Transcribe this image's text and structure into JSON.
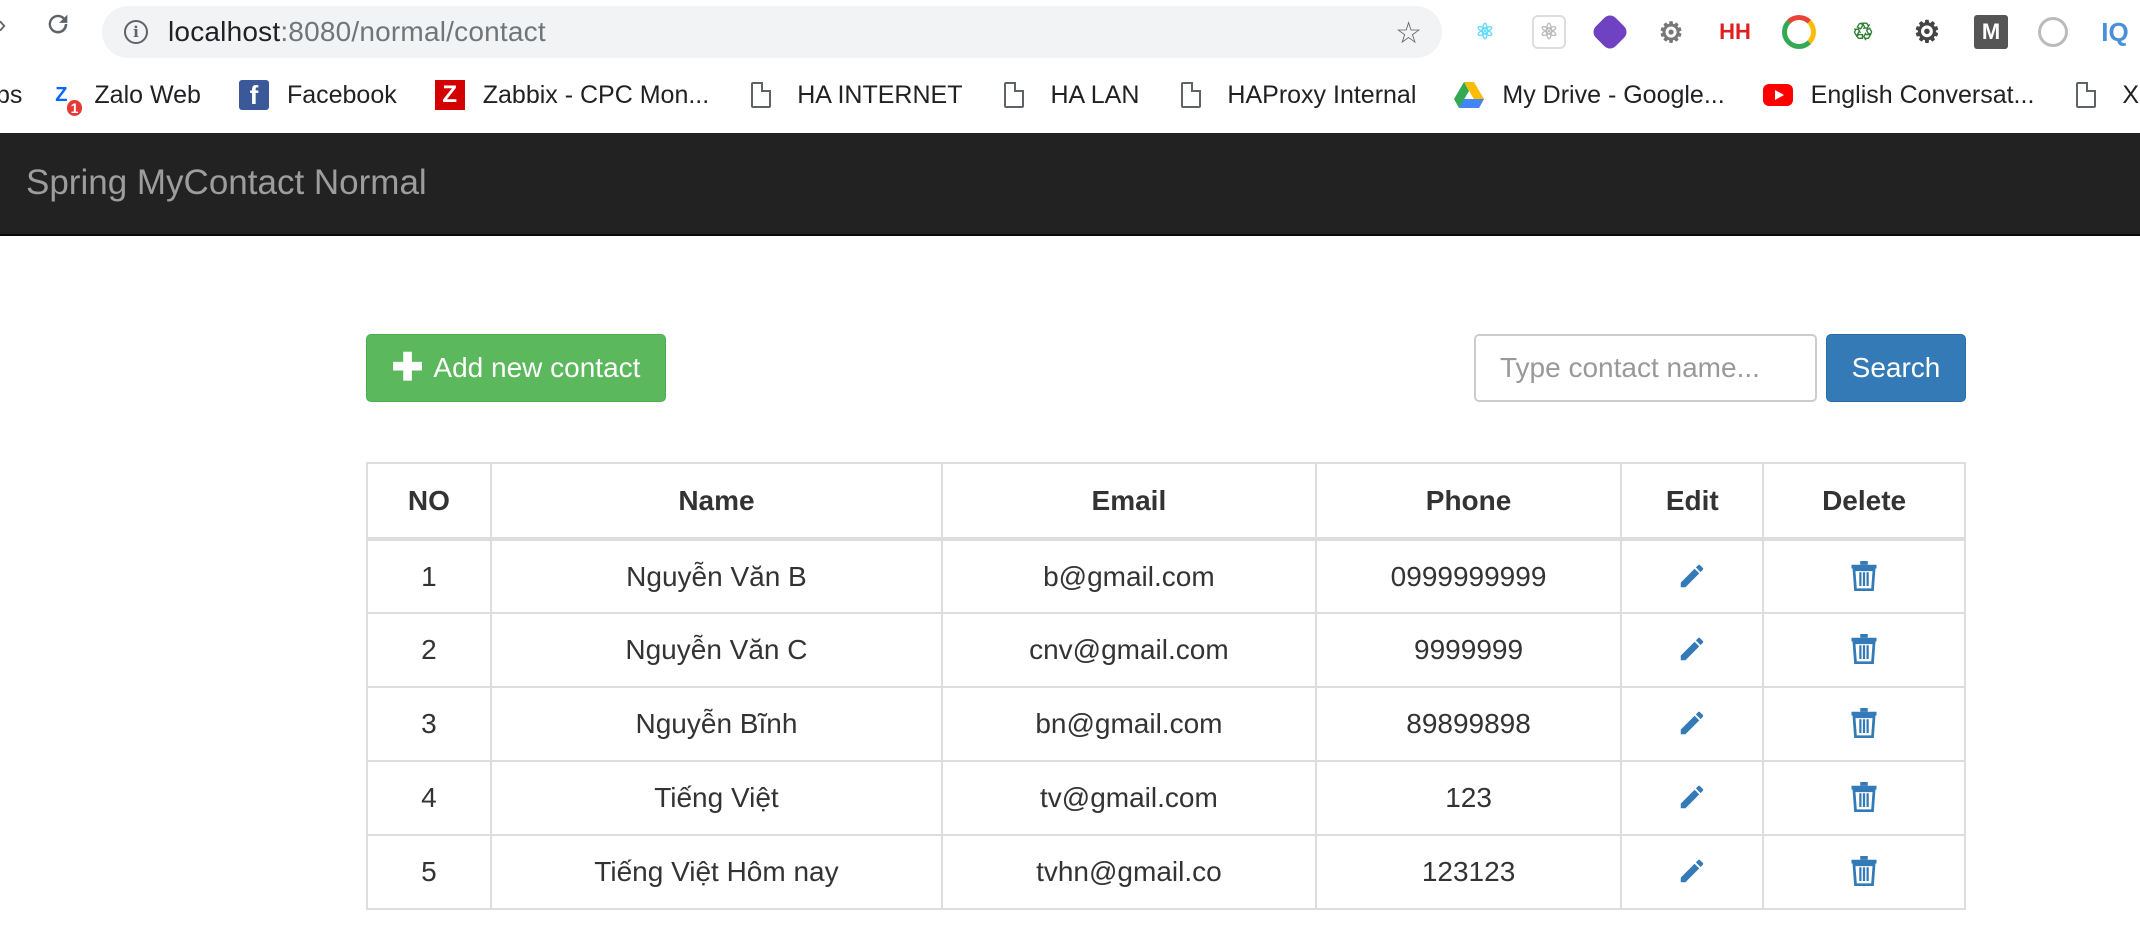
{
  "browser": {
    "url_host": "localhost",
    "url_rest": ":8080/normal/contact",
    "extensions": [
      "react-devtools-icon",
      "react-devtools-disabled-icon",
      "extension-purple-icon",
      "settings-gear-icon",
      "hh-icon",
      "chrome-pen-icon",
      "extension-green-icon",
      "gear-dark-icon",
      "m-icon",
      "record-icon"
    ],
    "bookmarks": [
      {
        "label": "Zalo Web",
        "icon": "zalo-icon"
      },
      {
        "label": "Facebook",
        "icon": "facebook-icon"
      },
      {
        "label": "Zabbix - CPC Mon...",
        "icon": "zabbix-icon"
      },
      {
        "label": "HA INTERNET",
        "icon": "document-icon"
      },
      {
        "label": "HA LAN",
        "icon": "document-icon"
      },
      {
        "label": "HAProxy Internal",
        "icon": "document-icon"
      },
      {
        "label": "My Drive - Google...",
        "icon": "google-drive-icon"
      },
      {
        "label": "English Conversat...",
        "icon": "youtube-icon"
      },
      {
        "label": "Xde",
        "icon": "document-icon"
      }
    ],
    "bookmarks_prefix": "ps",
    "hh_label": "HH",
    "m_label": "M",
    "iq_label": "IQ",
    "zalo_badge": "1"
  },
  "navbar": {
    "brand": "Spring MyContact Normal"
  },
  "toolbar": {
    "add_label": "Add new contact",
    "search_placeholder": "Type contact name...",
    "search_label": "Search"
  },
  "table": {
    "headers": [
      "NO",
      "Name",
      "Email",
      "Phone",
      "Edit",
      "Delete"
    ],
    "rows": [
      {
        "no": "1",
        "name": "Nguyễn Văn B",
        "email": "b@gmail.com",
        "phone": "0999999999"
      },
      {
        "no": "2",
        "name": "Nguyễn Văn C",
        "email": "cnv@gmail.com",
        "phone": "9999999"
      },
      {
        "no": "3",
        "name": "Nguyễn Bĩnh",
        "email": "bn@gmail.com",
        "phone": "89899898"
      },
      {
        "no": "4",
        "name": "Tiếng Việt",
        "email": "tv@gmail.com",
        "phone": "123"
      },
      {
        "no": "5",
        "name": "Tiếng Việt Hôm nay",
        "email": "tvhn@gmail.co",
        "phone": "123123"
      }
    ]
  },
  "colors": {
    "success": "#5cb85c",
    "primary": "#337ab7",
    "navbar": "#222222"
  }
}
